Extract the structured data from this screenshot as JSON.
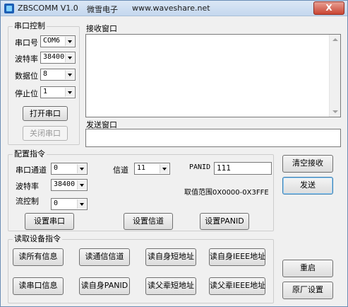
{
  "titlebar": {
    "app_name": "ZBSCOMM V1.0",
    "company": "微雪电子",
    "website": "www.waveshare.net",
    "close_label": "X"
  },
  "serial": {
    "group_title": "串口控制",
    "port_label": "串口号",
    "port_value": "COM6",
    "baud_label": "波特率",
    "baud_value": "38400",
    "databits_label": "数据位",
    "databits_value": "8",
    "stopbits_label": "停止位",
    "stopbits_value": "1",
    "open_button": "打开串口",
    "close_button": "关闭串口"
  },
  "receive": {
    "label": "接收窗口",
    "content": ""
  },
  "send": {
    "label": "发送窗口",
    "content": ""
  },
  "config": {
    "group_title": "配置指令",
    "serial_channel_label": "串口通道",
    "serial_channel_value": "0",
    "channel_label": "信道",
    "channel_value": "11",
    "panid_label": "PANID",
    "panid_value": "111",
    "baud_label": "波特率",
    "baud_value": "38400",
    "range_text": "取值范围0X0000-0X3FFE",
    "flow_label": "流控制",
    "flow_value": "0",
    "set_serial_button": "设置串口",
    "set_channel_button": "设置信道",
    "set_panid_button": "设置PANID"
  },
  "right_buttons": {
    "clear_receive": "清空接收",
    "send": "发送",
    "restart": "重启",
    "factory_reset": "原厂设置"
  },
  "read": {
    "group_title": "读取设备指令",
    "buttons": [
      "读所有信息",
      "读通信信道",
      "读自身短地址",
      "读自身IEEE地址",
      "读串口信息",
      "读自身PANID",
      "读父辈短地址",
      "读父辈IEEE地址"
    ]
  }
}
